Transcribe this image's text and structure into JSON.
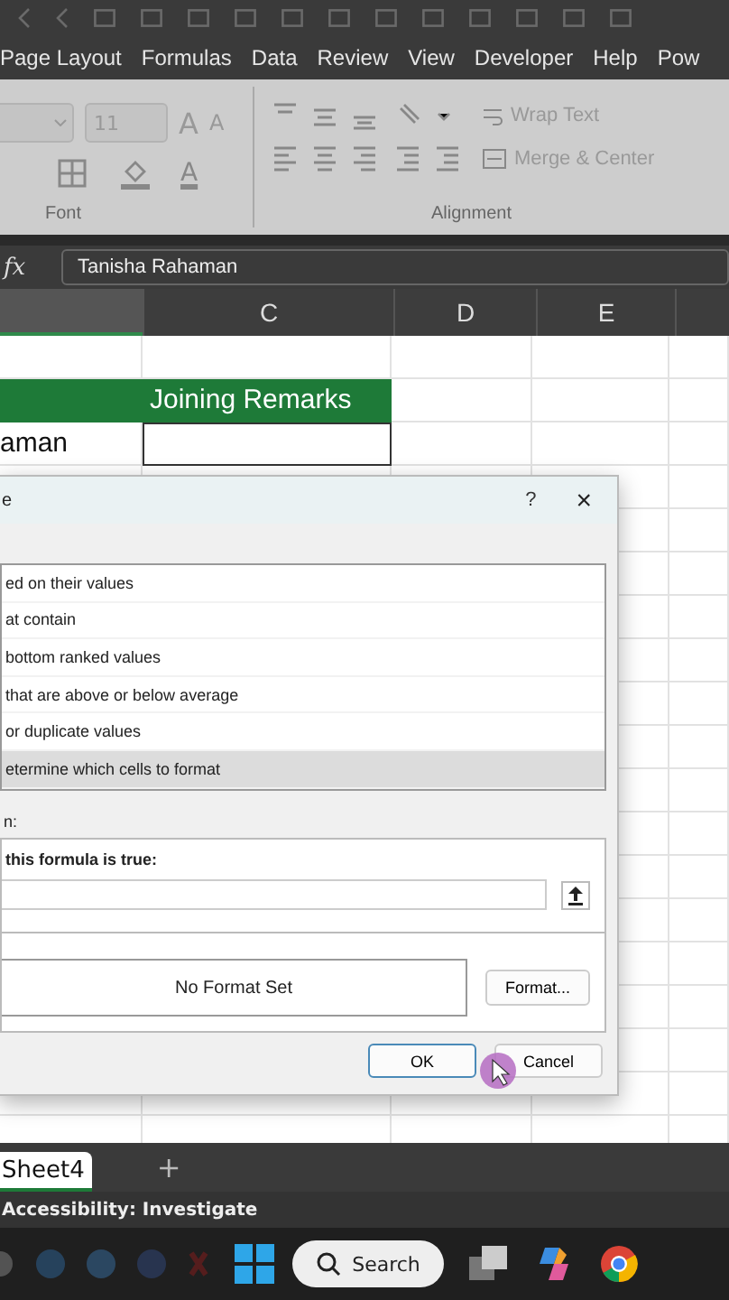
{
  "ribbon_tabs": [
    "Page Layout",
    "Formulas",
    "Data",
    "Review",
    "View",
    "Developer",
    "Help",
    "Pow"
  ],
  "font_group": {
    "size": "11",
    "grow": "A",
    "shrink": "A",
    "color_glyph": "A",
    "label": "Font"
  },
  "alignment_group": {
    "wrap_text": "Wrap Text",
    "merge": "Merge & Center",
    "label": "Alignment"
  },
  "formula_bar": {
    "fx": "fx",
    "value": "Tanisha Rahaman"
  },
  "columns": [
    "C",
    "D",
    "E"
  ],
  "cells": {
    "header": "Joining Remarks",
    "name": "aman"
  },
  "dialog": {
    "title": "e",
    "help": "?",
    "close": "×",
    "rule_types": [
      {
        "label": "ed on their values",
        "selected": false
      },
      {
        "label": "at contain",
        "selected": false
      },
      {
        "label": "bottom ranked values",
        "selected": false
      },
      {
        "label": "that are above or below average",
        "selected": false
      },
      {
        "label": "or duplicate values",
        "selected": false
      },
      {
        "label": "etermine which cells to format",
        "selected": true
      }
    ],
    "edit_label": "n:",
    "formula_label": "this formula is true:",
    "preview": "No Format Set",
    "format_button": "Format...",
    "ok": "OK",
    "cancel": "Cancel"
  },
  "sheet_tabs": [
    {
      "label": "Sheet4",
      "selected": true
    }
  ],
  "add_sheet": "+",
  "status": "Accessibility: Investigate",
  "taskbar": {
    "search": "Search"
  }
}
